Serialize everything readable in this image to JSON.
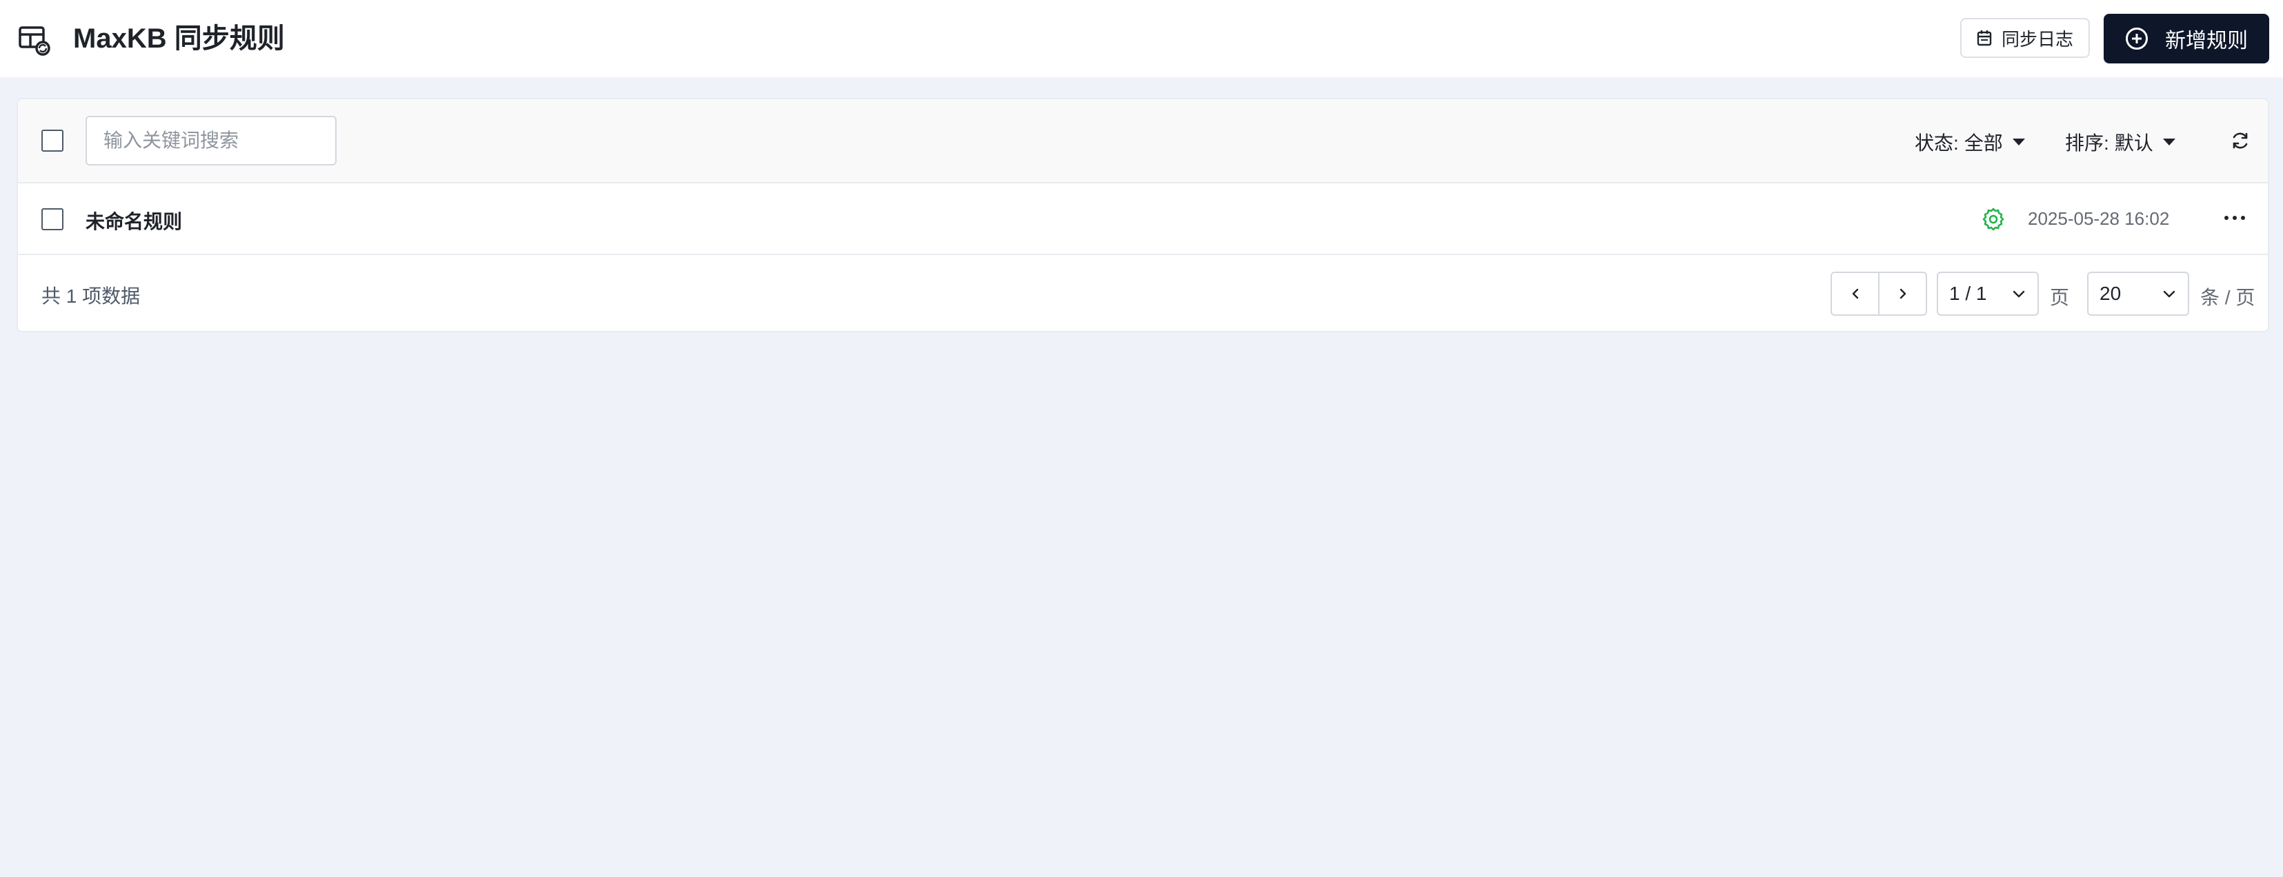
{
  "header": {
    "title": "MaxKB 同步规则",
    "icon": "table-sync-icon",
    "log_button_label": "同步日志",
    "new_button_label": "新增规则"
  },
  "toolbar": {
    "search_placeholder": "输入关键词搜索",
    "status_label": "状态:",
    "status_value": "全部",
    "sort_label": "排序:",
    "sort_value": "默认"
  },
  "rows": [
    {
      "name": "未命名规则",
      "status_icon": "gear-icon",
      "status_color": "#22b34c",
      "date": "2025-05-28 16:02"
    }
  ],
  "footer": {
    "total_text": "共 1 项数据",
    "page_value": "1 / 1",
    "page_unit": "页",
    "page_size": "20",
    "page_size_unit": "条 / 页"
  },
  "colors": {
    "primary_button": "#0e1629",
    "background": "#eff2f9",
    "status_green": "#22b34c"
  }
}
